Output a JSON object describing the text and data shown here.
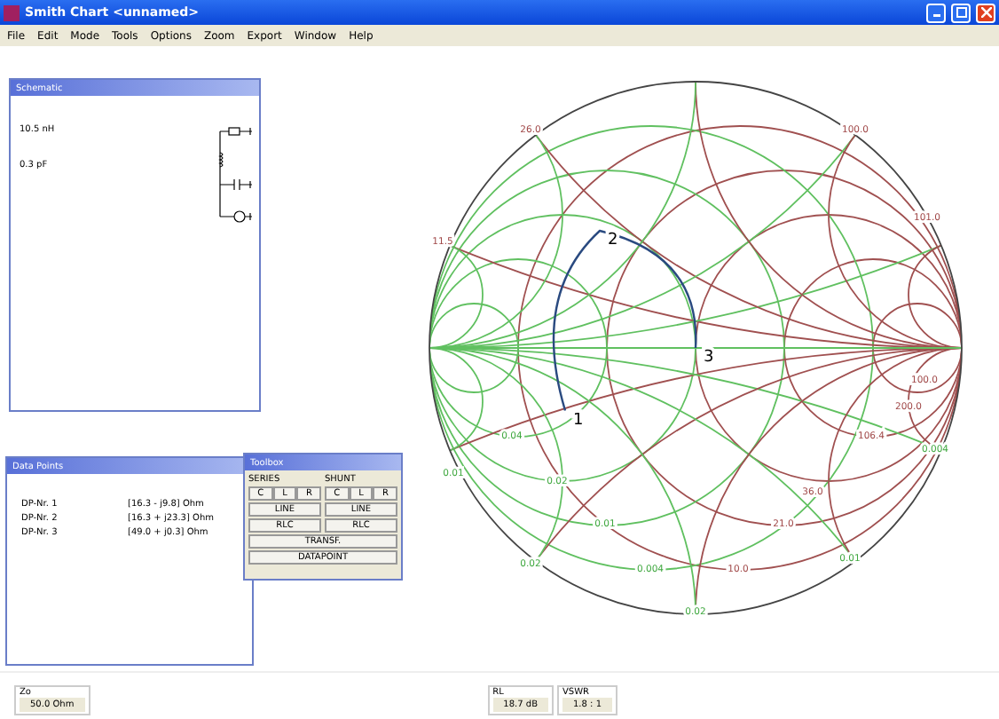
{
  "window": {
    "title": "Smith Chart <unnamed>"
  },
  "menu": [
    "File",
    "Edit",
    "Mode",
    "Tools",
    "Options",
    "Zoom",
    "Export",
    "Window",
    "Help"
  ],
  "schematic": {
    "title": "Schematic",
    "values": [
      "10.5 nH",
      "0.3 pF"
    ]
  },
  "data_points": {
    "title": "Data Points",
    "rows": [
      {
        "name": "DP-Nr. 1",
        "value": "[16.3 - j9.8] Ohm"
      },
      {
        "name": "DP-Nr. 2",
        "value": "[16.3 + j23.3] Ohm"
      },
      {
        "name": "DP-Nr. 3",
        "value": "[49.0 + j0.3] Ohm"
      }
    ]
  },
  "toolbox": {
    "title": "Toolbox",
    "groups": [
      {
        "label": "SERIES",
        "elements": [
          "C",
          "L",
          "R"
        ],
        "buttons": [
          "LINE",
          "RLC"
        ]
      },
      {
        "label": "SHUNT",
        "elements": [
          "C",
          "L",
          "R"
        ],
        "buttons": [
          "LINE",
          "RLC"
        ]
      }
    ],
    "wide_buttons": [
      "TRANSF.",
      "DATAPOINT"
    ]
  },
  "chart": {
    "points": [
      "1",
      "2",
      "3"
    ],
    "scale_labels": [
      {
        "text": "26.0",
        "kind": "reactance"
      },
      {
        "text": "100.0",
        "kind": "reactance"
      },
      {
        "text": "101.0",
        "kind": "reactance"
      },
      {
        "text": "11.5",
        "kind": "reactance"
      },
      {
        "text": "100.0",
        "kind": "reactance"
      },
      {
        "text": "200.0",
        "kind": "reactance"
      },
      {
        "text": "106.4",
        "kind": "reactance"
      },
      {
        "text": "36.0",
        "kind": "reactance"
      },
      {
        "text": "21.0",
        "kind": "reactance"
      },
      {
        "text": "10.0",
        "kind": "reactance"
      },
      {
        "text": "0.04",
        "kind": "susceptance"
      },
      {
        "text": "0.02",
        "kind": "susceptance"
      },
      {
        "text": "0.01",
        "kind": "susceptance"
      },
      {
        "text": "0.004",
        "kind": "susceptance"
      },
      {
        "text": "0.02",
        "kind": "susceptance"
      },
      {
        "text": "0.01",
        "kind": "susceptance"
      },
      {
        "text": "0.004",
        "kind": "susceptance"
      },
      {
        "text": "0.02",
        "kind": "susceptance"
      },
      {
        "text": "0.01",
        "kind": "susceptance"
      }
    ]
  },
  "status_bar": [
    {
      "label": "Zo",
      "value": "50.0 Ohm"
    },
    {
      "label": "RL",
      "value": "18.7 dB"
    },
    {
      "label": "VSWR",
      "value": "1.8 : 1"
    }
  ]
}
